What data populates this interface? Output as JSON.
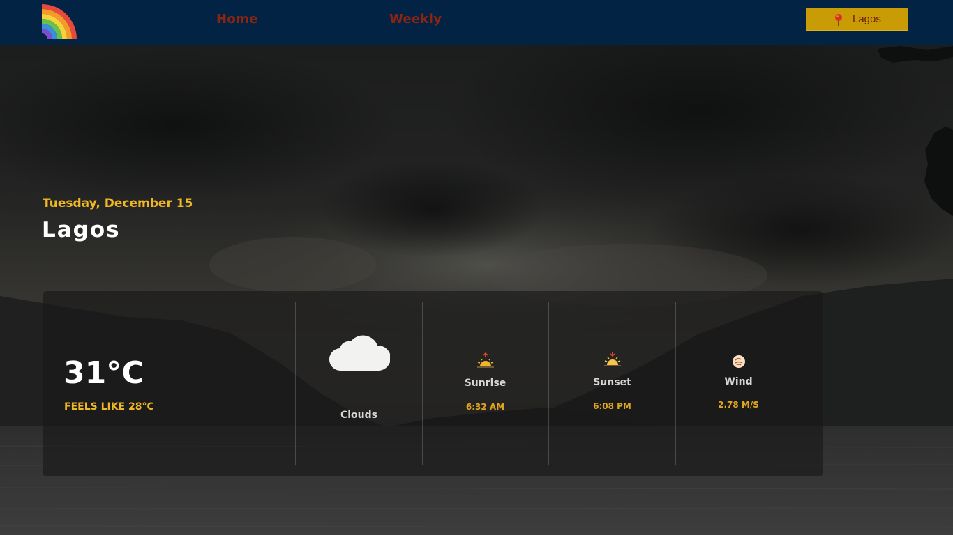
{
  "navbar": {
    "logo_icon": "rainbow-logo-icon",
    "links": [
      {
        "label": "Home"
      },
      {
        "label": "Weekly"
      }
    ],
    "location_button": {
      "icon": "map-pin-icon",
      "label": "Lagos"
    }
  },
  "headline": {
    "date": "Tuesday, December 15",
    "city": "Lagos"
  },
  "weather": {
    "temperature": "31°C",
    "feels_like": "FEELS LIKE 28°C",
    "condition": {
      "icon": "cloud-icon",
      "label": "Clouds"
    },
    "sunrise": {
      "icon": "sunrise-icon",
      "label": "Sunrise",
      "value": "6:32 AM"
    },
    "sunset": {
      "icon": "sunset-icon",
      "label": "Sunset",
      "value": "6:08 PM"
    },
    "wind": {
      "icon": "wind-icon",
      "label": "Wind",
      "value": "2.78 M/S"
    }
  },
  "colors": {
    "navbar_bg": "#022343",
    "nav_link": "#8d2412",
    "accent_yellow": "#f2b824",
    "location_button_bg": "#c99c06"
  }
}
